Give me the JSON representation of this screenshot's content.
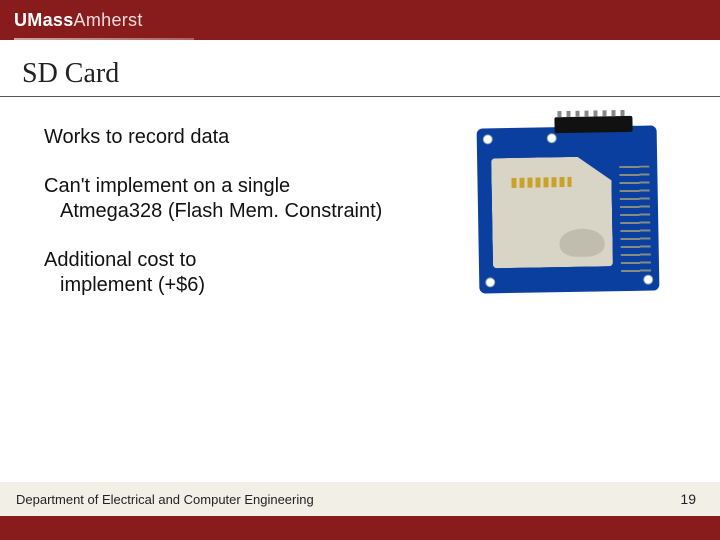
{
  "header": {
    "logo_part1": "UMass",
    "logo_part2": "Amherst"
  },
  "slide": {
    "title": "SD Card",
    "bullets": [
      {
        "line1": "Works to record data",
        "line2": ""
      },
      {
        "line1": "Can't implement on a single",
        "line2": "Atmega328 (Flash Mem. Constraint)"
      },
      {
        "line1": "Additional cost to",
        "line2": "implement (+$6)"
      }
    ]
  },
  "image": {
    "alt": "sd-card-breakout-module"
  },
  "footer": {
    "department": "Department of Electrical and Computer Engineering",
    "page_number": "19"
  }
}
